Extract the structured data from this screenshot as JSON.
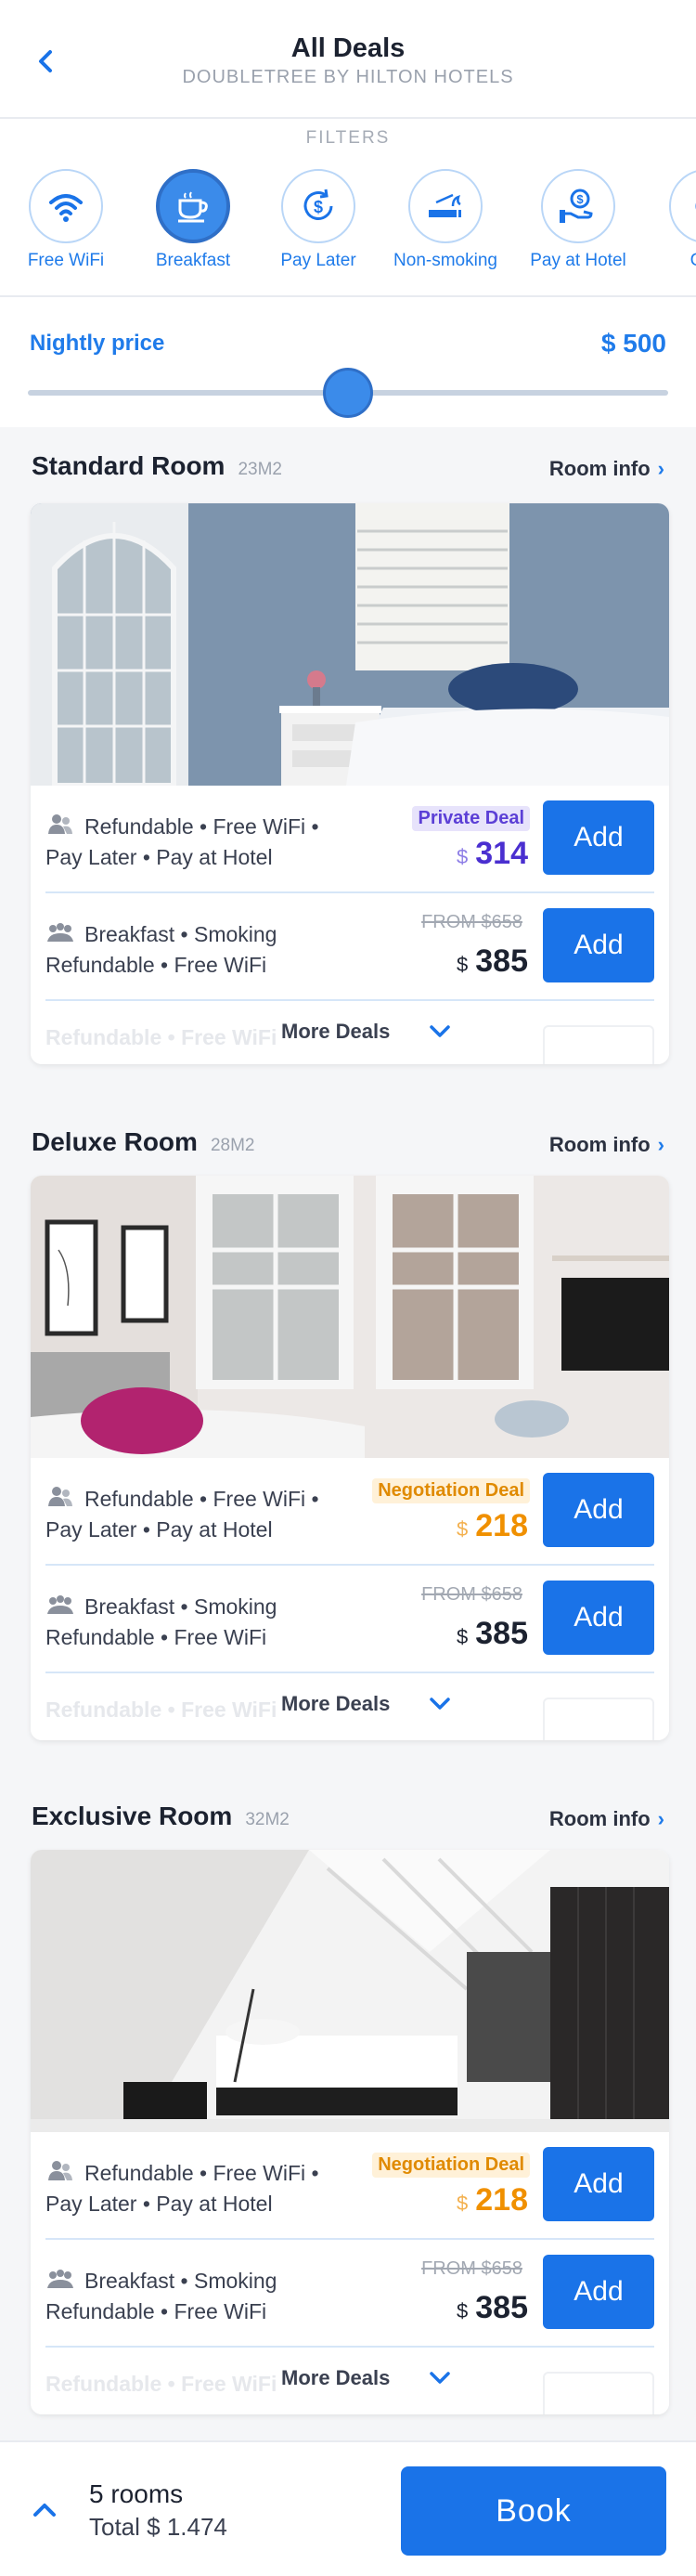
{
  "header": {
    "title": "All Deals",
    "subtitle": "DOUBLETREE BY HILTON HOTELS",
    "back_icon": "chevron-left-icon"
  },
  "filters": {
    "label": "FILTERS",
    "items": [
      {
        "label": "Free WiFi",
        "icon": "wifi-icon",
        "active": false
      },
      {
        "label": "Breakfast",
        "icon": "coffee-cup-icon",
        "active": true
      },
      {
        "label": "Pay Later",
        "icon": "pay-later-icon",
        "active": false
      },
      {
        "label": "Non-smoking",
        "icon": "no-smoking-icon",
        "active": false
      },
      {
        "label": "Pay at Hotel",
        "icon": "hand-money-icon",
        "active": false
      },
      {
        "label": "Can",
        "icon": "partial-icon",
        "active": false
      }
    ]
  },
  "price": {
    "label": "Nightly price",
    "value": "$ 500",
    "slider_fraction": 0.5
  },
  "rooms": [
    {
      "name": "Standard Room",
      "size": "23M2",
      "info": "Room info",
      "deals": [
        {
          "line1": "Refundable • Free WiFi •",
          "line2": "Pay Later • Pay at Hotel",
          "badge": "Private Deal",
          "currency": "$",
          "price": "314",
          "add": "Add"
        },
        {
          "line1": "Breakfast • Smoking",
          "line2": "Refundable • Free WiFi",
          "from": "FROM $658",
          "currency": "$",
          "price": "385",
          "add": "Add"
        }
      ],
      "more": {
        "faded": "Refundable • Free WiFi",
        "label": "More Deals"
      }
    },
    {
      "name": "Deluxe Room",
      "size": "28M2",
      "info": "Room info",
      "deals": [
        {
          "line1": "Refundable • Free WiFi •",
          "line2": "Pay Later • Pay at Hotel",
          "badge": "Negotiation Deal",
          "currency": "$",
          "price": "218",
          "add": "Add"
        },
        {
          "line1": "Breakfast • Smoking",
          "line2": "Refundable • Free WiFi",
          "from": "FROM $658",
          "currency": "$",
          "price": "385",
          "add": "Add"
        }
      ],
      "more": {
        "faded": "Refundable • Free WiFi",
        "label": "More Deals"
      }
    },
    {
      "name": "Exclusive Room",
      "size": "32M2",
      "info": "Room info",
      "deals": [
        {
          "line1": "Refundable • Free WiFi •",
          "line2": "Pay Later • Pay at Hotel",
          "badge": "Negotiation Deal",
          "currency": "$",
          "price": "218",
          "add": "Add"
        },
        {
          "line1": "Breakfast • Smoking",
          "line2": "Refundable • Free WiFi",
          "from": "FROM $658",
          "currency": "$",
          "price": "385",
          "add": "Add"
        }
      ],
      "more": {
        "faded": "Refundable • Free WiFi",
        "label": "More Deals"
      }
    }
  ],
  "footer": {
    "rooms": "5 rooms",
    "total": "Total $ 1.474",
    "book": "Book"
  },
  "colors": {
    "accent": "#1a73e8",
    "private": "#4a2fd0",
    "negotiation": "#f09000"
  }
}
